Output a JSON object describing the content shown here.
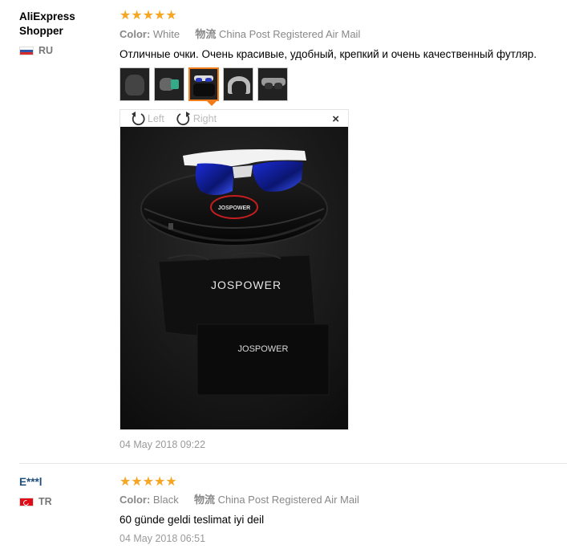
{
  "reviews": [
    {
      "username": "AliExpress Shopper",
      "country": "RU",
      "stars": "★★★★★",
      "color_label": "Color:",
      "color_value": "White",
      "shipping_label": "物流",
      "shipping_value": "China Post Registered Air Mail",
      "feedback": "Отличные очки. Очень красивые, удобный, крепкий и очень качественный футляр.",
      "date": "04 May 2018 09:22"
    },
    {
      "username": "E***l",
      "country": "TR",
      "stars": "★★★★★",
      "color_label": "Color:",
      "color_value": "Black",
      "shipping_label": "物流",
      "shipping_value": "China Post Registered Air Mail",
      "feedback": "60 günde geldi teslimat iyi deil",
      "date": "04 May 2018 06:51"
    }
  ],
  "viewer": {
    "rotate_left": "Left",
    "rotate_right": "Right",
    "close": "×",
    "brand_case": "JOSPOWER",
    "brand_pouch": "JOSPOWER",
    "brand_card": "JOSPOWER"
  },
  "colors": {
    "star": "#f5a623",
    "active_thumb_border": "#f07d1a",
    "username_link": "#1f4d7a"
  }
}
